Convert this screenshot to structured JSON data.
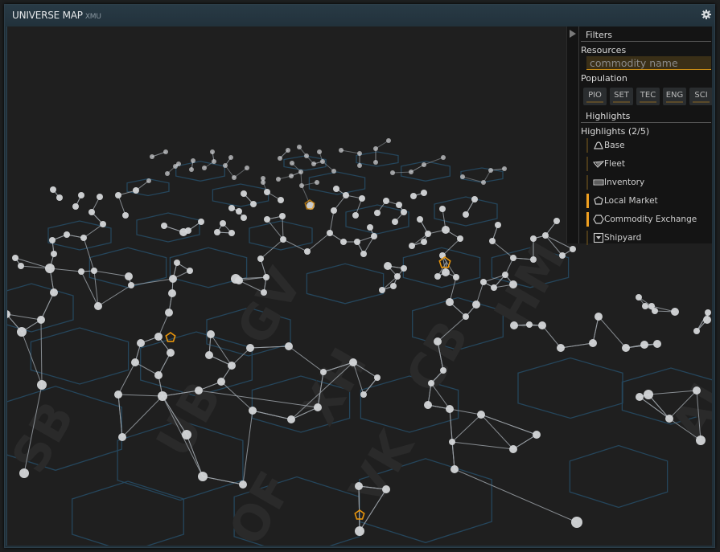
{
  "window": {
    "title": "UNIVERSE MAP",
    "subtitle": "XMU",
    "settings_icon": "gear-icon"
  },
  "panel": {
    "collapse_icon": "triangle-right-icon",
    "filters_heading": "Filters",
    "resources_label": "Resources",
    "commodity_placeholder": "commodity name",
    "commodity_value": "",
    "population_label": "Population",
    "population_buttons": [
      "PIO",
      "SET",
      "TEC",
      "ENG",
      "SCI"
    ],
    "highlights_heading": "Highlights",
    "highlights_count_label": "Highlights (2/5)",
    "highlights": [
      {
        "label": "Base",
        "icon": "base-icon",
        "active": false
      },
      {
        "label": "Fleet",
        "icon": "fleet-icon",
        "active": false
      },
      {
        "label": "Inventory",
        "icon": "inventory-icon",
        "active": false
      },
      {
        "label": "Local Market",
        "icon": "local-market-icon",
        "active": true
      },
      {
        "label": "Commodity Exchange",
        "icon": "commodity-exchange-icon",
        "active": true
      },
      {
        "label": "Shipyard",
        "icon": "shipyard-icon",
        "active": false
      }
    ]
  },
  "map": {
    "colors": {
      "background": "#1f1f1f",
      "hex_outline": "#25465c",
      "edge": "#9aa0a6",
      "node": "#d4d6d8",
      "highlight": "#e8950c"
    },
    "sector_labels": [
      "SB",
      "UB",
      "OF",
      "VK",
      "HM",
      "GV",
      "XH",
      "CB",
      "AJ"
    ],
    "market_markers": 4
  }
}
